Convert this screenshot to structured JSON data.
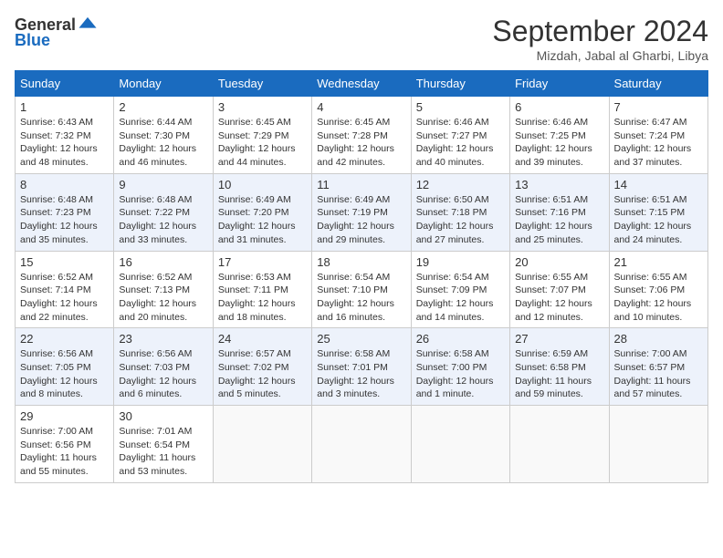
{
  "header": {
    "logo_general": "General",
    "logo_blue": "Blue",
    "month_title": "September 2024",
    "location": "Mizdah, Jabal al Gharbi, Libya"
  },
  "weekdays": [
    "Sunday",
    "Monday",
    "Tuesday",
    "Wednesday",
    "Thursday",
    "Friday",
    "Saturday"
  ],
  "weeks": [
    [
      {
        "day": "1",
        "sunrise": "6:43 AM",
        "sunset": "7:32 PM",
        "daylight": "12 hours and 48 minutes."
      },
      {
        "day": "2",
        "sunrise": "6:44 AM",
        "sunset": "7:30 PM",
        "daylight": "12 hours and 46 minutes."
      },
      {
        "day": "3",
        "sunrise": "6:45 AM",
        "sunset": "7:29 PM",
        "daylight": "12 hours and 44 minutes."
      },
      {
        "day": "4",
        "sunrise": "6:45 AM",
        "sunset": "7:28 PM",
        "daylight": "12 hours and 42 minutes."
      },
      {
        "day": "5",
        "sunrise": "6:46 AM",
        "sunset": "7:27 PM",
        "daylight": "12 hours and 40 minutes."
      },
      {
        "day": "6",
        "sunrise": "6:46 AM",
        "sunset": "7:25 PM",
        "daylight": "12 hours and 39 minutes."
      },
      {
        "day": "7",
        "sunrise": "6:47 AM",
        "sunset": "7:24 PM",
        "daylight": "12 hours and 37 minutes."
      }
    ],
    [
      {
        "day": "8",
        "sunrise": "6:48 AM",
        "sunset": "7:23 PM",
        "daylight": "12 hours and 35 minutes."
      },
      {
        "day": "9",
        "sunrise": "6:48 AM",
        "sunset": "7:22 PM",
        "daylight": "12 hours and 33 minutes."
      },
      {
        "day": "10",
        "sunrise": "6:49 AM",
        "sunset": "7:20 PM",
        "daylight": "12 hours and 31 minutes."
      },
      {
        "day": "11",
        "sunrise": "6:49 AM",
        "sunset": "7:19 PM",
        "daylight": "12 hours and 29 minutes."
      },
      {
        "day": "12",
        "sunrise": "6:50 AM",
        "sunset": "7:18 PM",
        "daylight": "12 hours and 27 minutes."
      },
      {
        "day": "13",
        "sunrise": "6:51 AM",
        "sunset": "7:16 PM",
        "daylight": "12 hours and 25 minutes."
      },
      {
        "day": "14",
        "sunrise": "6:51 AM",
        "sunset": "7:15 PM",
        "daylight": "12 hours and 24 minutes."
      }
    ],
    [
      {
        "day": "15",
        "sunrise": "6:52 AM",
        "sunset": "7:14 PM",
        "daylight": "12 hours and 22 minutes."
      },
      {
        "day": "16",
        "sunrise": "6:52 AM",
        "sunset": "7:13 PM",
        "daylight": "12 hours and 20 minutes."
      },
      {
        "day": "17",
        "sunrise": "6:53 AM",
        "sunset": "7:11 PM",
        "daylight": "12 hours and 18 minutes."
      },
      {
        "day": "18",
        "sunrise": "6:54 AM",
        "sunset": "7:10 PM",
        "daylight": "12 hours and 16 minutes."
      },
      {
        "day": "19",
        "sunrise": "6:54 AM",
        "sunset": "7:09 PM",
        "daylight": "12 hours and 14 minutes."
      },
      {
        "day": "20",
        "sunrise": "6:55 AM",
        "sunset": "7:07 PM",
        "daylight": "12 hours and 12 minutes."
      },
      {
        "day": "21",
        "sunrise": "6:55 AM",
        "sunset": "7:06 PM",
        "daylight": "12 hours and 10 minutes."
      }
    ],
    [
      {
        "day": "22",
        "sunrise": "6:56 AM",
        "sunset": "7:05 PM",
        "daylight": "12 hours and 8 minutes."
      },
      {
        "day": "23",
        "sunrise": "6:56 AM",
        "sunset": "7:03 PM",
        "daylight": "12 hours and 6 minutes."
      },
      {
        "day": "24",
        "sunrise": "6:57 AM",
        "sunset": "7:02 PM",
        "daylight": "12 hours and 5 minutes."
      },
      {
        "day": "25",
        "sunrise": "6:58 AM",
        "sunset": "7:01 PM",
        "daylight": "12 hours and 3 minutes."
      },
      {
        "day": "26",
        "sunrise": "6:58 AM",
        "sunset": "7:00 PM",
        "daylight": "12 hours and 1 minute."
      },
      {
        "day": "27",
        "sunrise": "6:59 AM",
        "sunset": "6:58 PM",
        "daylight": "11 hours and 59 minutes."
      },
      {
        "day": "28",
        "sunrise": "7:00 AM",
        "sunset": "6:57 PM",
        "daylight": "11 hours and 57 minutes."
      }
    ],
    [
      {
        "day": "29",
        "sunrise": "7:00 AM",
        "sunset": "6:56 PM",
        "daylight": "11 hours and 55 minutes."
      },
      {
        "day": "30",
        "sunrise": "7:01 AM",
        "sunset": "6:54 PM",
        "daylight": "11 hours and 53 minutes."
      },
      null,
      null,
      null,
      null,
      null
    ]
  ]
}
